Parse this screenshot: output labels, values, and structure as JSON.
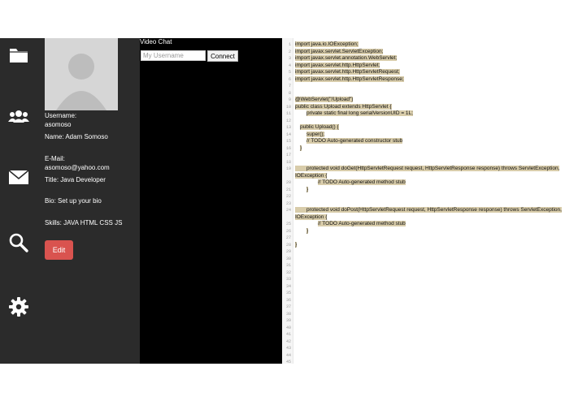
{
  "sidebar": {
    "icons": [
      "folder-icon",
      "users-icon",
      "mail-icon",
      "search-icon",
      "gear-icon"
    ],
    "colors": {
      "background": "#2b2b2b",
      "icon": "#ffffff"
    }
  },
  "profile": {
    "username_label": "Username:",
    "username": "asomoso",
    "name_label": "Name:",
    "name": "Adam Somoso",
    "email_label": "E-Mail:",
    "email": "asomoso@yahoo.com",
    "title_label": "Title:",
    "title": "Java Developer",
    "bio_label": "Bio:",
    "bio": "Set up your bio",
    "skills_label": "Skills:",
    "skills": "JAVA HTML CSS JS",
    "edit_label": "Edit",
    "edit_color": "#d9534f"
  },
  "video_chat": {
    "title": "Video Chat",
    "username_placeholder": "My Username",
    "connect_label": "Connect"
  },
  "editor": {
    "line_numbers": [
      "1",
      "2",
      "3",
      "4",
      "5",
      "6",
      "7",
      "8",
      "9",
      "10",
      "11",
      "12",
      "13",
      "14",
      "15",
      "16",
      "17",
      "18",
      "19",
      "20",
      "21",
      "22",
      "23",
      "24",
      "25",
      "26",
      "27",
      "28",
      "29",
      "30",
      "31",
      "32",
      "33",
      "34",
      "35",
      "36",
      "37",
      "38",
      "39",
      "40",
      "41",
      "42",
      "43",
      "44",
      "45"
    ],
    "lines": [
      "import java.io.IOException;",
      "import javax.servlet.ServletException;",
      "import javax.servlet.annotation.WebServlet;",
      "import javax.servlet.http.HttpServlet;",
      "import javax.servlet.http.HttpServletRequest;",
      "import javax.servlet.http.HttpServletResponse;",
      "",
      "",
      "@WebServlet(\"/Upload\")",
      "public class Upload extends HttpServlet {",
      "    private static final long serialVersionUID = 1L;",
      "",
      "  public Upload() {",
      "    super();",
      "    // TODO Auto-generated constructor stub",
      "  }",
      "",
      "",
      "    protected void doGet(HttpServletRequest request, HttpServletResponse response) throws ServletException, IOException {",
      "        // TODO Auto-generated method stub",
      "    }",
      "",
      "",
      "    protected void doPost(HttpServletRequest request, HttpServletResponse response) throws ServletException, IOException {",
      "        // TODO Auto-generated method stub",
      "    }",
      "",
      "}"
    ],
    "highlight_color": "#d8ccaa"
  }
}
